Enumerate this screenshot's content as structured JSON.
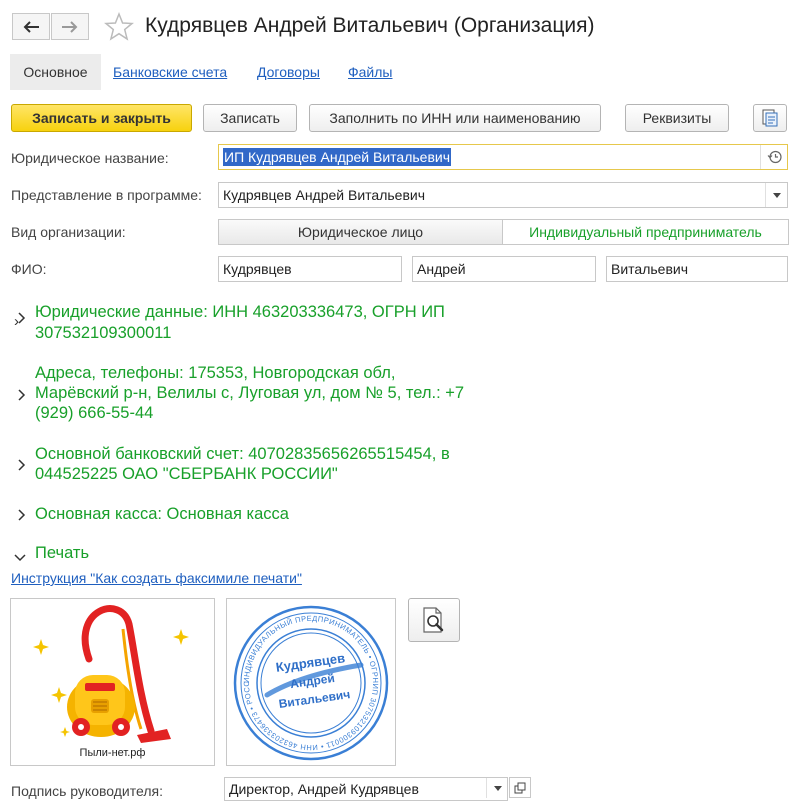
{
  "header": {
    "back_icon": "arrow-left-icon",
    "forward_icon": "arrow-right-icon",
    "favorite_icon": "star-icon",
    "title": "Кудрявцев Андрей Витальевич (Организация)"
  },
  "tabs": [
    {
      "label": "Основное",
      "active": true
    },
    {
      "label": "Банковские счета"
    },
    {
      "label": "Договоры"
    },
    {
      "label": "Файлы"
    }
  ],
  "toolbar": {
    "save_close": "Записать и закрыть",
    "save": "Записать",
    "fill_inn": "Заполнить по ИНН или наименованию",
    "requisites": "Реквизиты",
    "report_icon": "report-icon"
  },
  "form": {
    "legal_name_label": "Юридическое название:",
    "legal_name_value": "ИП Кудрявцев Андрей Витальевич",
    "history_icon": "history-icon",
    "display_label": "Представление в программе:",
    "display_value": "Кудрявцев Андрей Витальевич",
    "org_type_label": "Вид организации:",
    "org_type_options": [
      "Юридическое лицо",
      "Индивидуальный предприниматель"
    ],
    "org_type_selected": "Индивидуальный предприниматель",
    "fio_label": "ФИО:",
    "last_name": "Кудрявцев",
    "first_name": "Андрей",
    "patronymic": "Витальевич"
  },
  "sections": {
    "legal_data_line1": "Юридические данные: ИНН 463203336473, ОГРН ИП",
    "legal_data_line2": "307532109300011",
    "address_line1": "Адреса, телефоны: 175353, Новгородская обл,",
    "address_line2": "Марёвский р-н, Велилы с, Луговая ул, дом № 5, тел.: +7",
    "address_line3": "(929) 666-55-44",
    "bank_line1": "Основной банковский счет: 40702835656265515454, в",
    "bank_line2": "044525225 ОАО \"СБЕРБАНК РОССИИ\"",
    "cash": "Основная касса: Основная касса",
    "print": "Печать"
  },
  "print": {
    "instruction_link": "Инструкция \"Как создать факсимиле печати\"",
    "logo_caption": "Пыли-нет.рф",
    "stamp_center": [
      "Кудрявцев",
      "Андрей",
      "Витальевич"
    ],
    "stamp_ring_text": "ИНДИВИДУАЛЬНЫЙ ПРЕДПРИНИМАТЕЛЬ • ОГРНИП 307532109300011 • ИНН 463203336473 • РОССИЯ НОВГОРОДСКАЯ ОБЛ •",
    "zoom_icon": "zoom-document-icon",
    "signature_label": "Подпись руководителя:",
    "signature_value": "Директор, Андрей Кудрявцев"
  },
  "colors": {
    "accent_yellow": "#f7d20e",
    "link_blue": "#1f5fbf",
    "group_green": "#18a02a",
    "stamp_blue": "#3a7fd5"
  }
}
